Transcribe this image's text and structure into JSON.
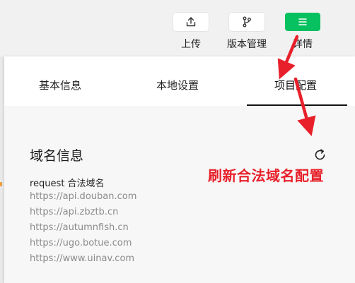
{
  "toolbar": {
    "upload_label": "上传",
    "version_label": "版本管理",
    "details_label": "详情",
    "upload_icon": "upload-icon",
    "version_icon": "branch-icon",
    "details_icon": "menu-icon",
    "accent": "#07c160"
  },
  "tabs": [
    {
      "label": "基本信息"
    },
    {
      "label": "本地设置"
    },
    {
      "label": "项目配置",
      "active": true
    }
  ],
  "domain_section": {
    "title": "域名信息",
    "request_label": "request 合法域名",
    "domains": [
      "https://api.douban.com",
      "https://api.zbztb.cn",
      "https://autumnfish.cn",
      "https://ugo.botue.com",
      "https://www.uinav.com"
    ]
  },
  "annotation": {
    "text": "刷新合法域名配置",
    "color": "#e8202a"
  }
}
